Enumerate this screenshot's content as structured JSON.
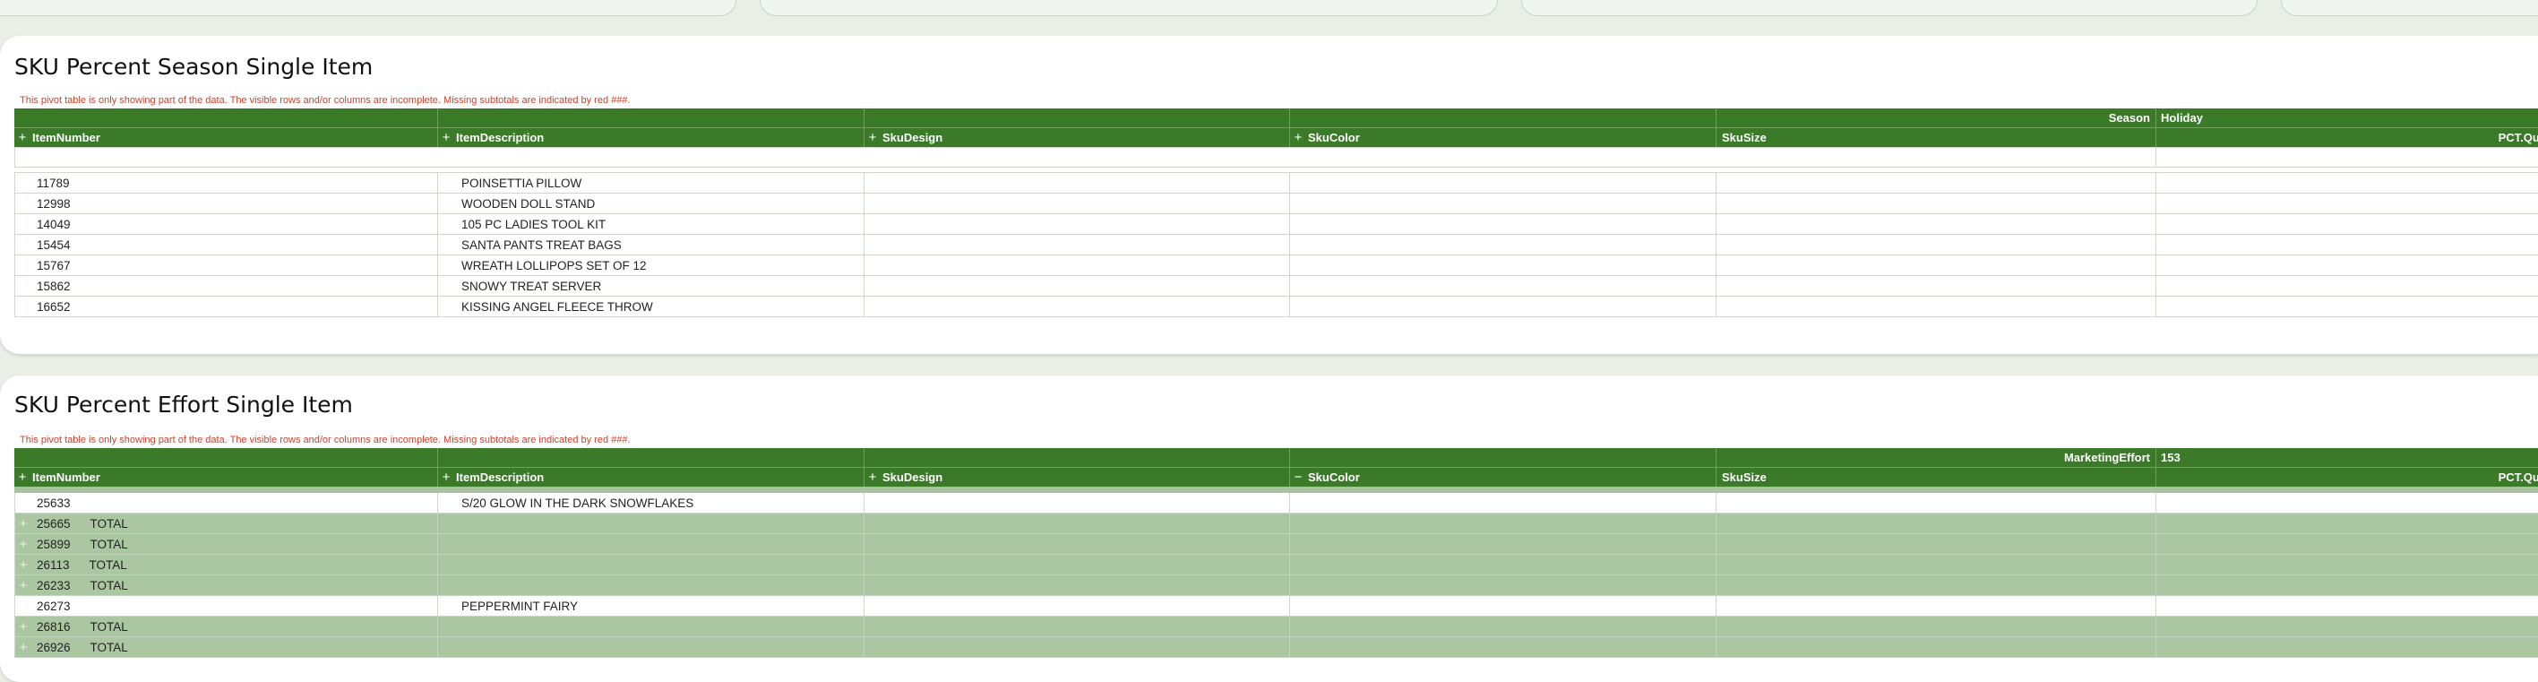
{
  "panels": [
    {
      "title": "SKU Percent Season Single Item",
      "warning": "This pivot table is only showing part of the data. The visible rows and/or columns are incomplete. Missing subtotals are indicated by red ###.",
      "filter_label": "Season",
      "filter_value": "Holiday",
      "columns": [
        "ItemNumber",
        "ItemDescription",
        "SkuDesign",
        "SkuColor",
        "SkuSize"
      ],
      "measure": "PCT.Quan",
      "rows": [
        {
          "item": "11789",
          "desc": "POINSETTIA PILLOW"
        },
        {
          "item": "12998",
          "desc": "WOODEN DOLL STAND"
        },
        {
          "item": "14049",
          "desc": "105 PC LADIES TOOL KIT"
        },
        {
          "item": "15454",
          "desc": "SANTA PANTS TREAT BAGS"
        },
        {
          "item": "15767",
          "desc": "WREATH LOLLIPOPS SET OF 12"
        },
        {
          "item": "15862",
          "desc": "SNOWY TREAT SERVER"
        },
        {
          "item": "16652",
          "desc": "KISSING ANGEL FLEECE THROW"
        }
      ]
    },
    {
      "title": "SKU Percent Effort Single Item",
      "warning": "This pivot table is only showing part of the data. The visible rows and/or columns are incomplete. Missing subtotals are indicated by red ###.",
      "filter_label": "MarketingEffort",
      "filter_value": "153",
      "columns": [
        "ItemNumber",
        "ItemDescription",
        "SkuDesign",
        "SkuColor",
        "SkuSize"
      ],
      "measure": "PCT.Quan",
      "rows": [
        {
          "item": "25633",
          "desc": "S/20 GLOW IN THE DARK SNOWFLAKES"
        },
        {
          "item": "25665",
          "total": "TOTAL"
        },
        {
          "item": "25899",
          "total": "TOTAL"
        },
        {
          "item": "26113",
          "total": "TOTAL"
        },
        {
          "item": "26233",
          "total": "TOTAL"
        },
        {
          "item": "26273",
          "desc": "PEPPERMINT FAIRY"
        },
        {
          "item": "26816",
          "total": "TOTAL"
        },
        {
          "item": "26926",
          "total": "TOTAL"
        }
      ]
    }
  ],
  "icons": {
    "expand": "+",
    "collapse": "−"
  }
}
